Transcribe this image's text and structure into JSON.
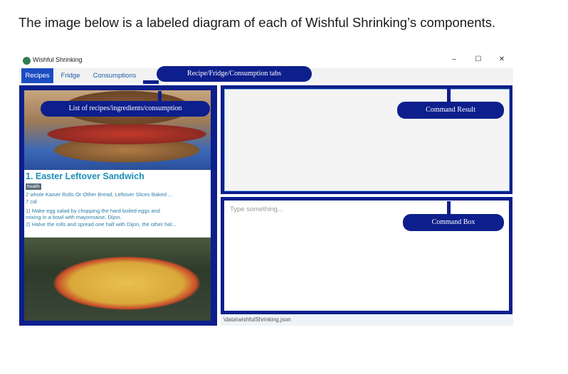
{
  "intro": "The image below is a labeled diagram of each of Wishful Shrinking’s components.",
  "window": {
    "title": "Wishful Shrinking",
    "controls": {
      "minimize": "–",
      "maximize": "☐",
      "close": "✕"
    }
  },
  "tabs": [
    "Recipes",
    "Fridge",
    "Consumptions"
  ],
  "recipe": {
    "title": "1.  Easter Leftover Sandwich",
    "tag": "health",
    "ingredients": "2 whole Kaiser Rolls Or Other Bread, Leftover Slices Baked ...",
    "calories": "7 cal",
    "instruction_1": "1) Make egg salad by chopping the hard boiled eggs and",
    "instruction_1b": "mixing in a bowl with mayonnaise, Dijon.",
    "instruction_2": "2) Halve the rolls and spread one half with Dijon, the other hal..."
  },
  "command_box": {
    "placeholder": "Type something..."
  },
  "status": "\\data\\wishfulShrinking.json",
  "callouts": {
    "tabs": "Recipe/Fridge/Consumption tabs",
    "list": "List of recipes/ingredients/consumption",
    "result": "Command Result",
    "command": "Command Box"
  },
  "colors": {
    "accent": "#0d1f8c",
    "tab_active": "#1b4dc2",
    "title": "#1d8fb8"
  }
}
